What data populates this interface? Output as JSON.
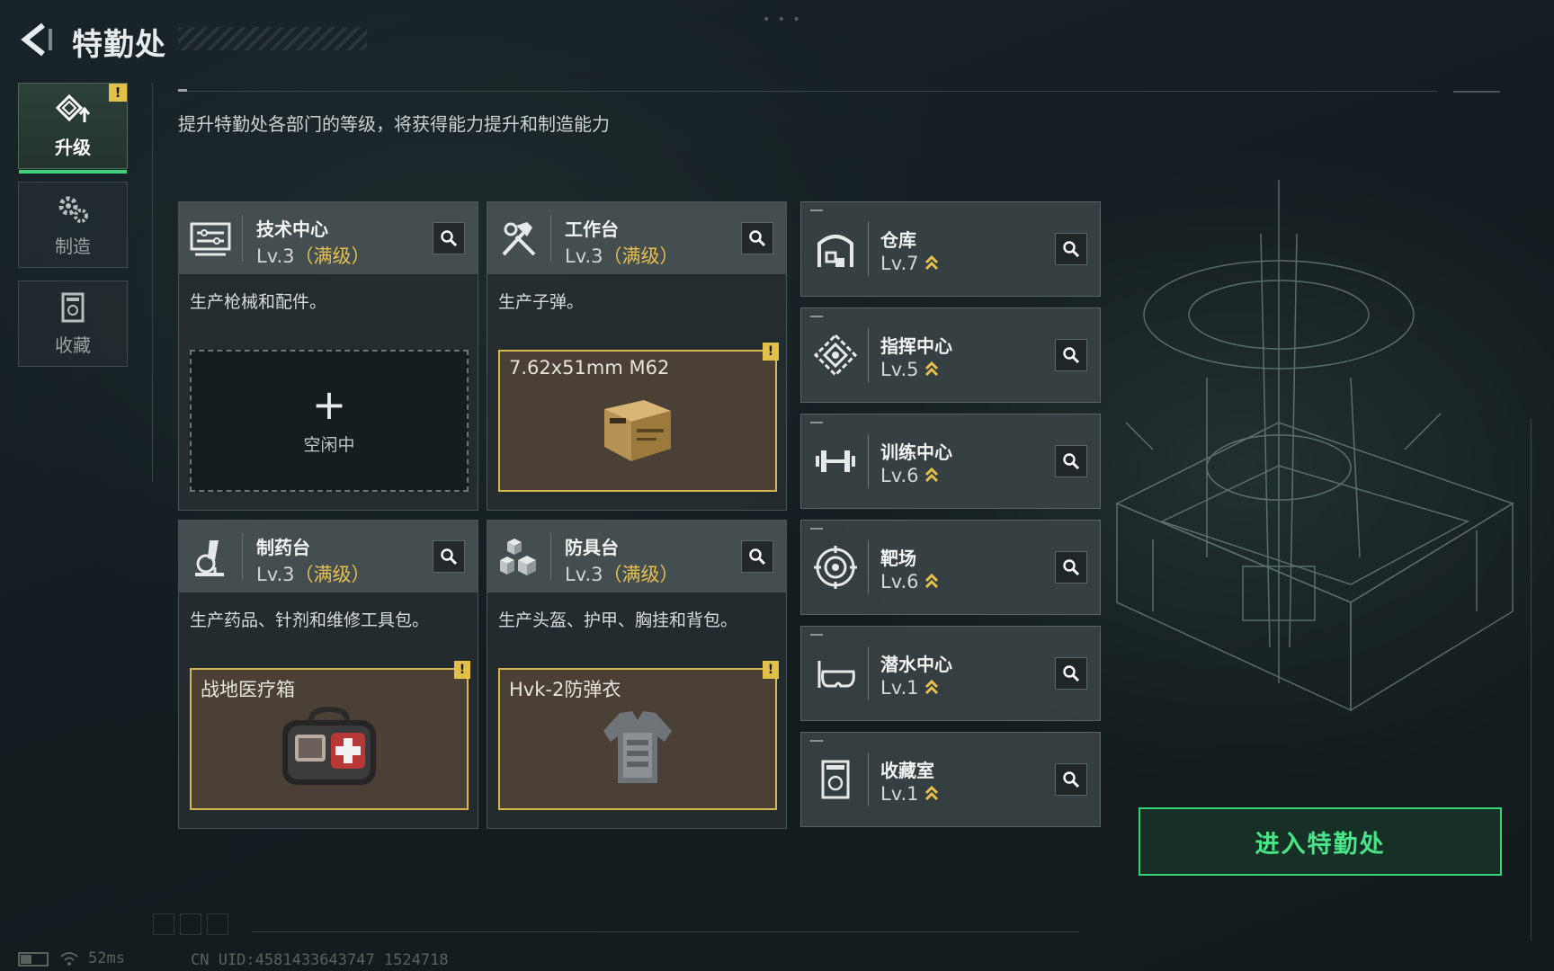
{
  "header": {
    "title": "特勤处"
  },
  "tabs": [
    {
      "label": "升级",
      "icon": "upgrade-icon",
      "active": true,
      "warning": "!"
    },
    {
      "label": "制造",
      "icon": "gears-icon",
      "active": false
    },
    {
      "label": "收藏",
      "icon": "collection-icon",
      "active": false
    }
  ],
  "subtitle": "提升特勤处各部门的等级，将获得能力提升和制造能力",
  "cards": [
    {
      "name": "技术中心",
      "level": "Lv.3",
      "maxed": "（满级）",
      "icon": "tech-center-icon",
      "desc": "生产枪械和配件。",
      "slot": {
        "state": "empty",
        "plus": "+",
        "label": "空闲中"
      }
    },
    {
      "name": "工作台",
      "level": "Lv.3",
      "maxed": "（满级）",
      "icon": "hammer-wrench-icon",
      "desc": "生产子弹。",
      "slot": {
        "state": "item",
        "label": "7.62x51mm M62",
        "warning": "!"
      }
    },
    {
      "name": "制药台",
      "level": "Lv.3",
      "maxed": "（满级）",
      "icon": "microscope-icon",
      "desc": "生产药品、针剂和维修工具包。",
      "slot": {
        "state": "item",
        "label": "战地医疗箱",
        "warning": "!"
      }
    },
    {
      "name": "防具台",
      "level": "Lv.3",
      "maxed": "（满级）",
      "icon": "cubes-icon",
      "desc": "生产头盔、护甲、胸挂和背包。",
      "slot": {
        "state": "item",
        "label": "Hvk-2防弹衣",
        "warning": "!"
      }
    }
  ],
  "departments": [
    {
      "name": "仓库",
      "level": "Lv.7",
      "icon": "warehouse-icon"
    },
    {
      "name": "指挥中心",
      "level": "Lv.5",
      "icon": "command-center-icon"
    },
    {
      "name": "训练中心",
      "level": "Lv.6",
      "icon": "dumbbell-icon"
    },
    {
      "name": "靶场",
      "level": "Lv.6",
      "icon": "target-icon"
    },
    {
      "name": "潜水中心",
      "level": "Lv.1",
      "icon": "diving-mask-icon"
    },
    {
      "name": "收藏室",
      "level": "Lv.1",
      "icon": "collection-room-icon"
    }
  ],
  "enter_button": "进入特勤处",
  "status": {
    "ping": "52ms",
    "uid": "CN UID:4581433643747 1524718"
  },
  "colors": {
    "accent_green": "#3ed57a",
    "gold": "#e6c04f",
    "warning": "#e3c04a"
  }
}
